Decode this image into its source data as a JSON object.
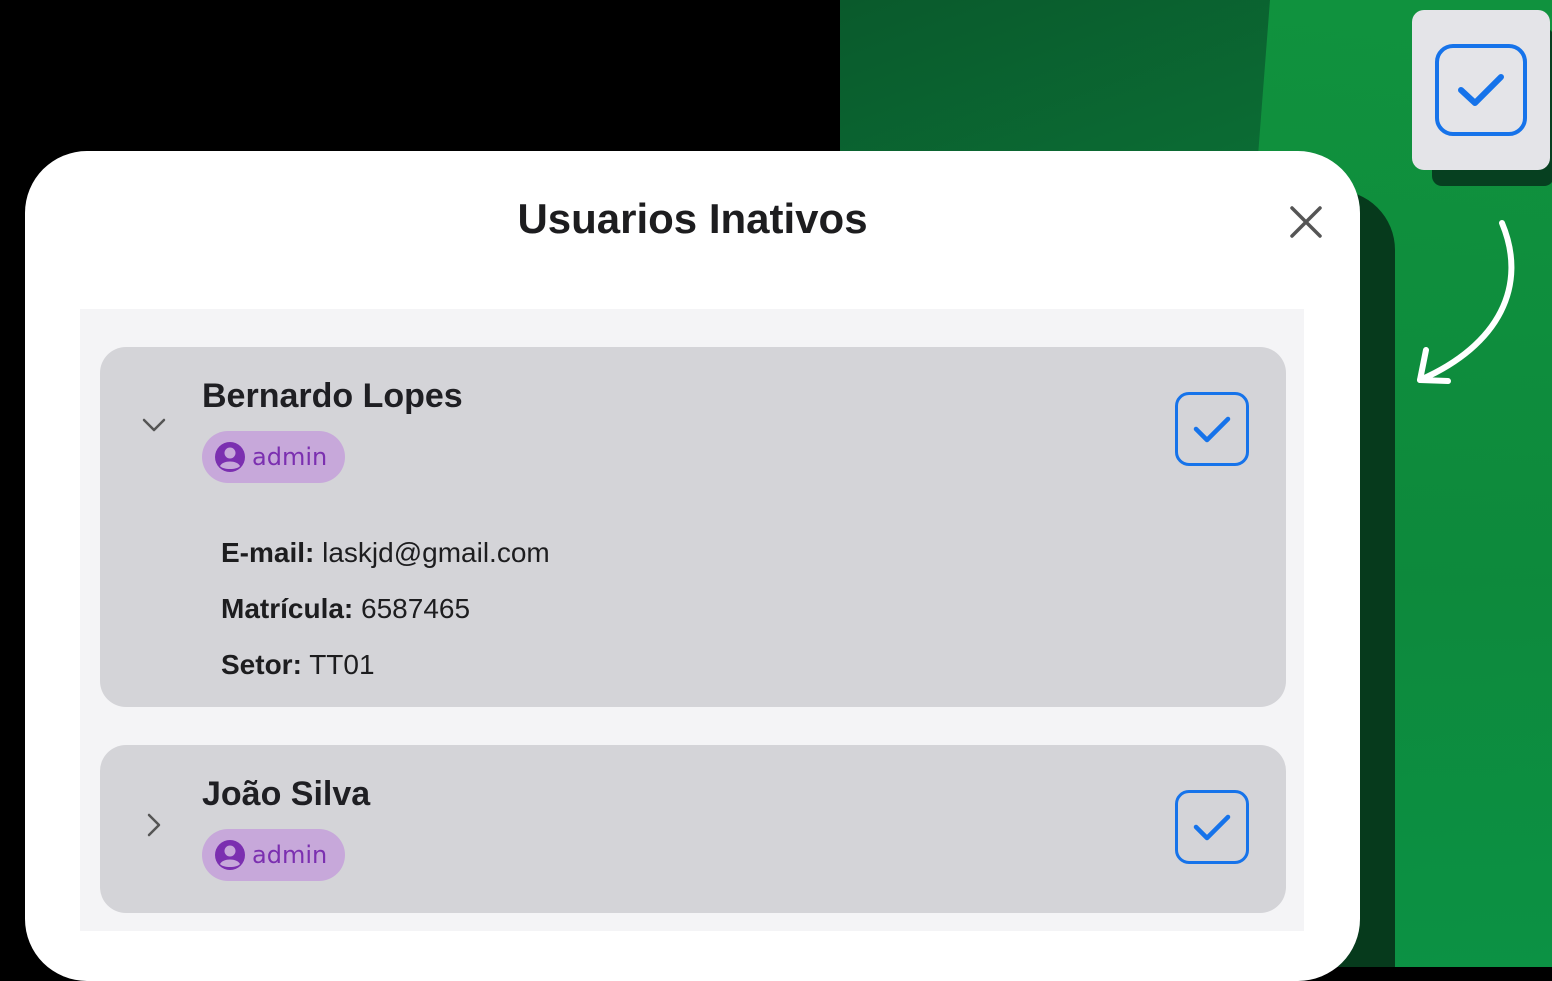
{
  "modal": {
    "title": "Usuarios Inativos",
    "close_icon": "close-icon"
  },
  "users": [
    {
      "name": "Bernardo Lopes",
      "role": "admin",
      "expanded": true,
      "checked": true,
      "details": {
        "email_label": "E-mail:",
        "email_value": "laskjd@gmail.com",
        "matricula_label": "Matrícula:",
        "matricula_value": "6587465",
        "setor_label": "Setor:",
        "setor_value": "TT01"
      }
    },
    {
      "name": "João Silva",
      "role": "admin",
      "expanded": false,
      "checked": true
    }
  ],
  "colors": {
    "accent_blue": "#1673ea",
    "badge_bg": "#c7a8da",
    "badge_text": "#7b2fb0",
    "card_bg": "#d4d4d8",
    "background_green": "#0c7a3a"
  },
  "icons": {
    "top_checkbox": "checkbox-checked-icon",
    "callout_arrow": "curved-arrow-icon",
    "expand_open": "chevron-down-icon",
    "expand_closed": "chevron-right-icon",
    "role": "user-circle-icon"
  }
}
